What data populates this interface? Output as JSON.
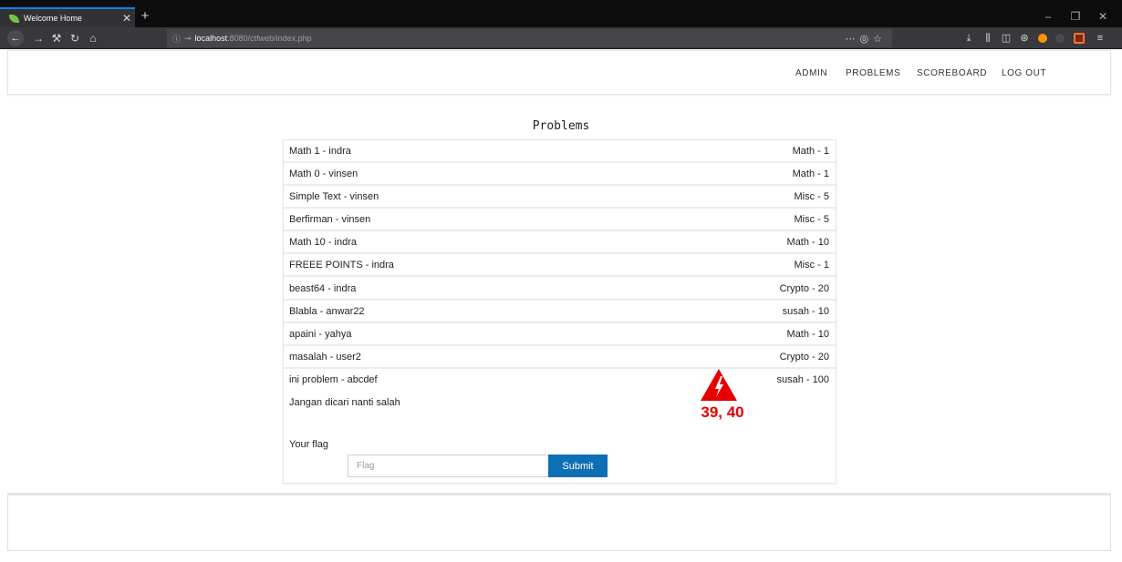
{
  "browser": {
    "tab_title": "Welcome Home",
    "tab_close": "✕",
    "new_tab": "+",
    "url_host": "localhost",
    "url_path": ":8080/ctfweb/index.php",
    "window_controls": [
      "–",
      "❐",
      "✕"
    ],
    "accent": "#0a84ff"
  },
  "nav": {
    "admin": "ADMIN",
    "problems": "PROBLEMS",
    "scoreboard": "SCOREBOARD",
    "logout": "LOG OUT"
  },
  "page_title": "Problems",
  "problems": [
    {
      "name": "Math 1 - indra",
      "category": "Math - 1"
    },
    {
      "name": "Math 0 - vinsen",
      "category": "Math - 1"
    },
    {
      "name": "Simple Text - vinsen",
      "category": "Misc - 5"
    },
    {
      "name": "Berfirman - vinsen",
      "category": "Misc - 5"
    },
    {
      "name": "Math 10 - indra",
      "category": "Math - 10"
    },
    {
      "name": "FREEE POINTS - indra",
      "category": "Misc - 1"
    },
    {
      "name": "beast64 - indra",
      "category": "Crypto - 20"
    },
    {
      "name": "Blabla - anwar22",
      "category": "susah - 10"
    },
    {
      "name": "apaini - yahya",
      "category": "Math - 10"
    },
    {
      "name": "masalah - user2",
      "category": "Crypto - 20"
    },
    {
      "name": "ini problem - abcdef",
      "category": "susah - 100"
    }
  ],
  "expanded_problem": {
    "description": "Jangan dicari nanti salah",
    "flag_label": "Your flag",
    "flag_placeholder": "Flag",
    "submit_label": "Submit",
    "submit_color": "#0d6fb4"
  },
  "marker": {
    "label": "39, 40",
    "color": "#e60000"
  }
}
